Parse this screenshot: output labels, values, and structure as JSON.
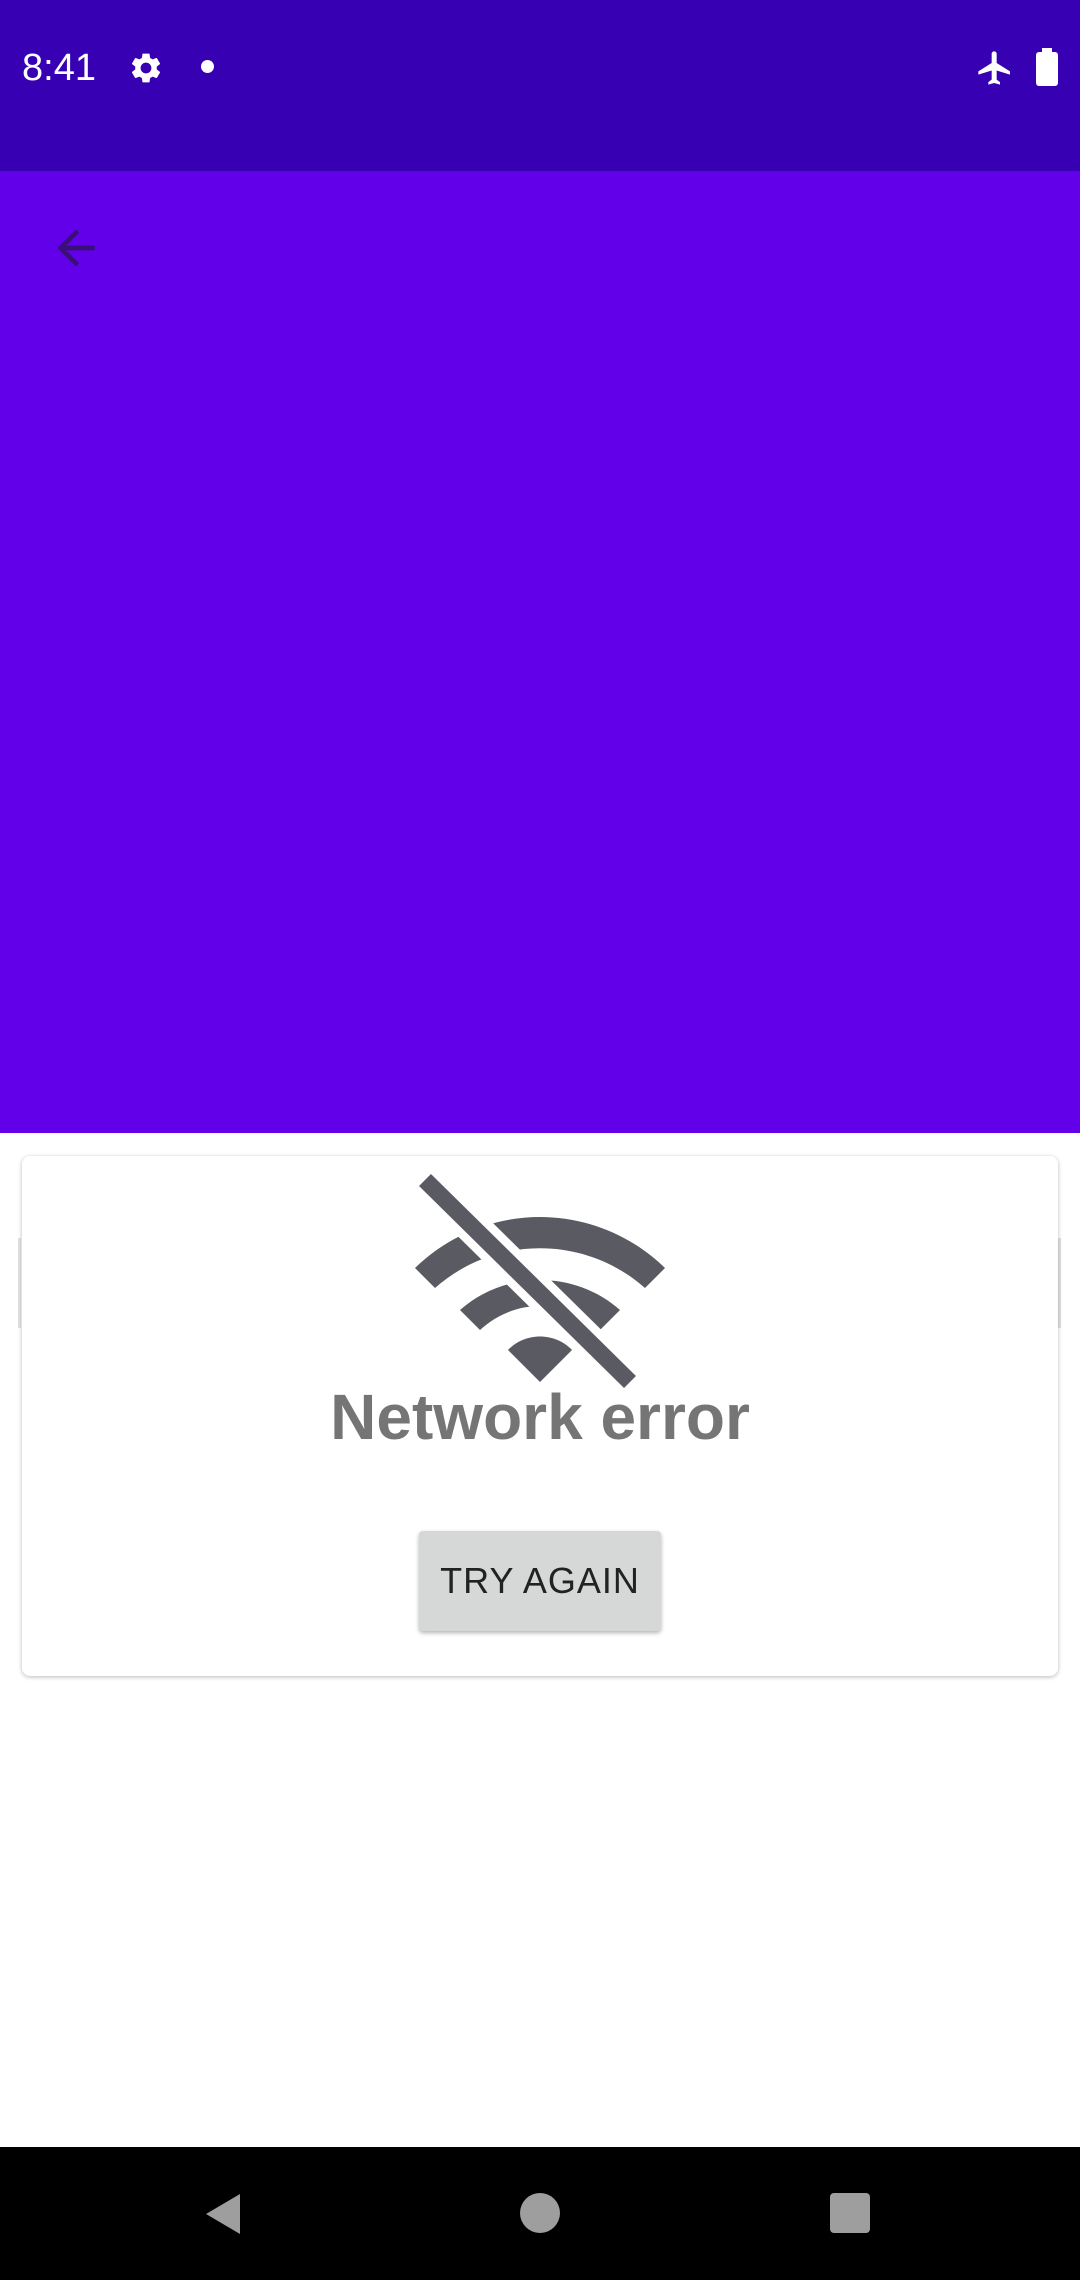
{
  "status_bar": {
    "time": "8:41",
    "icons": [
      "gear-icon",
      "notification-dot-icon",
      "airplane-mode-icon",
      "battery-icon"
    ],
    "background_color": "#3700b3"
  },
  "app_bar": {
    "back_icon": "arrow-back-icon",
    "background_color": "#6200ea"
  },
  "error_card": {
    "icon": "wifi-off-icon",
    "title": "Network error",
    "retry_label": "TRY AGAIN"
  },
  "nav_bar": {
    "icons": [
      "nav-back-icon",
      "nav-home-icon",
      "nav-recents-icon"
    ]
  }
}
